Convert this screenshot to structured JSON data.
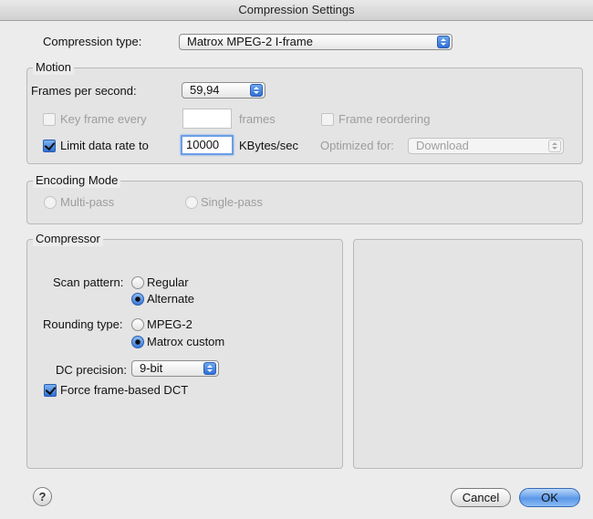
{
  "window": {
    "title": "Compression Settings"
  },
  "compression_type": {
    "label": "Compression type:",
    "value": "Matrox MPEG-2 I-frame"
  },
  "motion": {
    "title": "Motion",
    "fps_label": "Frames per second:",
    "fps_value": "59,94",
    "key_frame_label": "Key frame every",
    "key_frame_value": "",
    "key_frame_unit": "frames",
    "frame_reordering_label": "Frame reordering",
    "limit_data_rate_label": "Limit data rate to",
    "limit_data_rate_checked": true,
    "data_rate_value": "10000",
    "data_rate_unit": "KBytes/sec",
    "optimized_for_label": "Optimized for:",
    "optimized_for_value": "Download"
  },
  "encoding_mode": {
    "title": "Encoding Mode",
    "multi_pass_label": "Multi-pass",
    "single_pass_label": "Single-pass"
  },
  "compressor": {
    "title": "Compressor",
    "scan_pattern_label": "Scan pattern:",
    "scan_regular": "Regular",
    "scan_alternate": "Alternate",
    "scan_selected": "Alternate",
    "rounding_type_label": "Rounding type:",
    "rounding_mpeg2": "MPEG-2",
    "rounding_matrox": "Matrox custom",
    "rounding_selected": "Matrox custom",
    "dc_precision_label": "DC precision:",
    "dc_precision_value": "9-bit",
    "force_dct_label": "Force frame-based DCT",
    "force_dct_checked": true
  },
  "footer": {
    "help_label": "?",
    "cancel_label": "Cancel",
    "ok_label": "OK"
  }
}
